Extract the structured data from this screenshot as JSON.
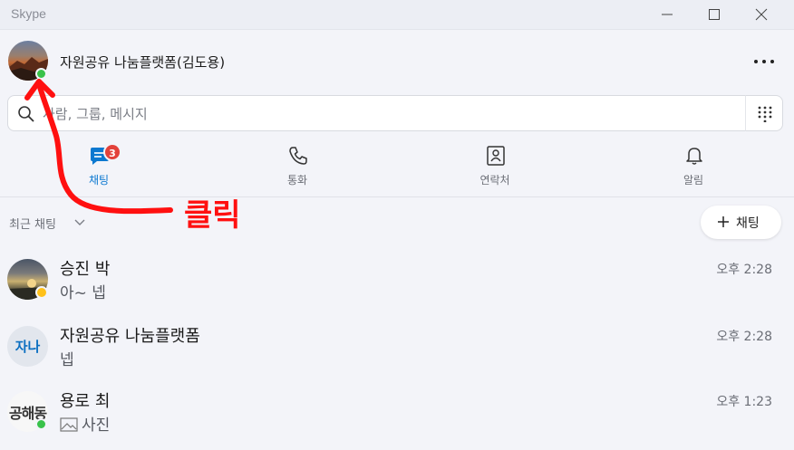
{
  "window": {
    "title": "Skype"
  },
  "profile": {
    "name": "자원공유 나눔플랫폼(김도용)",
    "presence": "online"
  },
  "search": {
    "placeholder": "사람, 그룹, 메시지"
  },
  "tabs": [
    {
      "label": "채팅",
      "icon": "chat-icon",
      "active": true,
      "badge": "3"
    },
    {
      "label": "통화",
      "icon": "phone-icon",
      "active": false
    },
    {
      "label": "연락처",
      "icon": "contacts-icon",
      "active": false
    },
    {
      "label": "알림",
      "icon": "bell-icon",
      "active": false
    }
  ],
  "recent": {
    "label": "최근 채팅",
    "new_chat_label": "채팅"
  },
  "conversations": [
    {
      "name": "승진 박",
      "preview": "아~ 넵",
      "time": "오후 2:28",
      "status": "away"
    },
    {
      "name": "자원공유 나눔플랫폼",
      "preview": "넵",
      "time": "오후 2:28",
      "initials": "자나"
    },
    {
      "name": "용로 최",
      "preview": "사진",
      "time": "오후 1:23",
      "status": "online",
      "avatar_text": "공해동"
    }
  ],
  "annotation": {
    "text": "클릭",
    "color": "#ff1010"
  },
  "colors": {
    "accent": "#0b78d0",
    "badge": "#e3413a",
    "online": "#39c24a",
    "away": "#ffc11a"
  }
}
